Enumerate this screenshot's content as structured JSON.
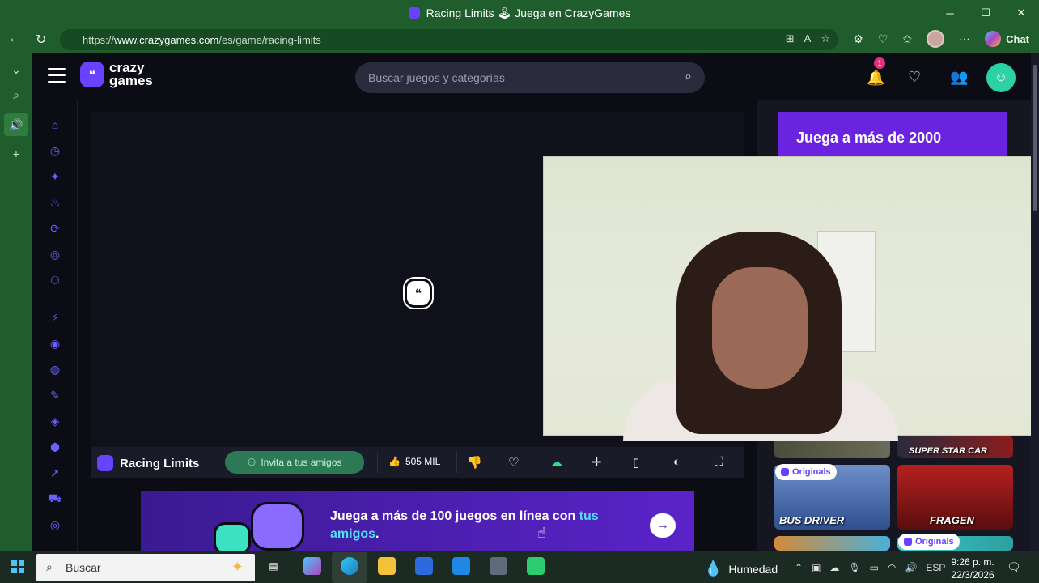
{
  "window": {
    "title": "Racing Limits 🕹 Juega en CrazyGames",
    "minimize": "─",
    "maximize": "☐",
    "close": "✕"
  },
  "browser": {
    "url_host": "www.crazygames.com",
    "url_prefix": "https://",
    "url_path": "/es/game/racing-limits",
    "chat_label": "Chat"
  },
  "site": {
    "logo_top": "crazy",
    "logo_bottom": "games",
    "search_placeholder": "Buscar juegos y categorías",
    "notification_count": "1"
  },
  "game": {
    "title": "Racing Limits",
    "invite_label": "Invita a tus amigos",
    "likes": "505 MIL"
  },
  "banner": {
    "text_main": "Juega a más de 100 juegos en línea con ",
    "text_highlight_1": "tus",
    "text_highlight_2": "amigos",
    "text_end": "."
  },
  "right_column": {
    "promo_text": "Juega a más de 2000",
    "thumbnails": [
      {
        "label": "SUPER STAR CAR"
      },
      {
        "label": "BUS DRIVER",
        "badge": "Originals"
      },
      {
        "label": "FRAGEN"
      },
      {
        "label": "",
        "badge": "Originals"
      }
    ]
  },
  "taskbar": {
    "search_placeholder": "Buscar",
    "weather": "Humedad",
    "language": "ESP",
    "time": "9:26 p. m.",
    "date": "22/3/2026"
  },
  "colors": {
    "brand_purple": "#6842ff",
    "browser_green": "#1f5e2c",
    "site_bg": "#0c0d14"
  }
}
